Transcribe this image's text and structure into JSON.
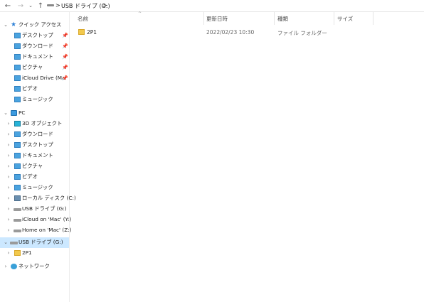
{
  "address": {
    "back_icon": "arrow-left-icon",
    "forward_icon": "arrow-right-icon",
    "recent_icon": "chevron-down-icon",
    "up_icon": "arrow-up-icon",
    "separator": ">",
    "location": "USB ドライブ (G:)",
    "trail_sep": ">"
  },
  "columns": {
    "name": "名前",
    "modified": "更新日時",
    "type": "種類",
    "size": "サイズ"
  },
  "files": [
    {
      "name": "2P1",
      "modified": "2022/02/23 10:30",
      "type": "ファイル フォルダー",
      "size": ""
    }
  ],
  "nav": {
    "quick_access": "クイック アクセス",
    "quick_items": [
      {
        "label": "デスクトップ",
        "pinned": true
      },
      {
        "label": "ダウンロード",
        "pinned": true
      },
      {
        "label": "ドキュメント",
        "pinned": true
      },
      {
        "label": "ピクチャ",
        "pinned": true
      },
      {
        "label": "iCloud Drive (Ma",
        "pinned": true
      },
      {
        "label": "ビデオ",
        "pinned": false
      },
      {
        "label": "ミュージック",
        "pinned": false
      }
    ],
    "pc": "PC",
    "pc_items": [
      {
        "label": "3D オブジェクト"
      },
      {
        "label": "ダウンロード"
      },
      {
        "label": "デスクトップ"
      },
      {
        "label": "ドキュメント"
      },
      {
        "label": "ピクチャ"
      },
      {
        "label": "ビデオ"
      },
      {
        "label": "ミュージック"
      },
      {
        "label": "ローカル ディスク (C:)"
      },
      {
        "label": "USB ドライブ (G:)"
      },
      {
        "label": "iCloud on 'Mac' (Y:)"
      },
      {
        "label": "Home on 'Mac' (Z:)"
      }
    ],
    "usb_selected": "USB ドライブ (G:)",
    "usb_child": "2P1",
    "network": "ネットワーク"
  },
  "colors": {
    "selection": "#cce8ff",
    "folder_yellow": "#f2c94c",
    "folder_blue": "#4aa3df"
  }
}
